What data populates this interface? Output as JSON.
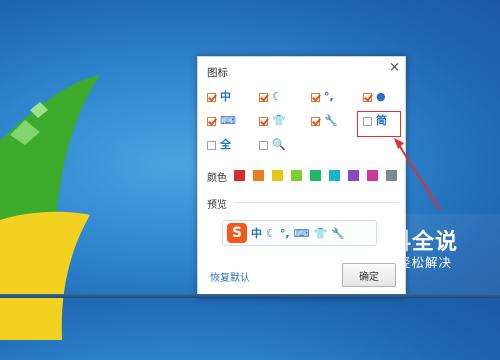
{
  "panel": {
    "title": "图标",
    "close_icon": "×",
    "icons": [
      {
        "name": "zhong-icon",
        "glyph": "中",
        "checked": true
      },
      {
        "name": "moon-icon",
        "glyph": "☾",
        "checked": true
      },
      {
        "name": "punctuation-icon",
        "glyph": "°,",
        "checked": true
      },
      {
        "name": "user-icon",
        "glyph": "●",
        "checked": true
      },
      {
        "name": "keyboard-icon",
        "glyph": "⌨",
        "checked": true
      },
      {
        "name": "shirt-icon",
        "glyph": "👕",
        "checked": true
      },
      {
        "name": "wrench-icon",
        "glyph": "🔧",
        "checked": true
      },
      {
        "name": "jian-icon",
        "glyph": "简",
        "checked": false
      },
      {
        "name": "quan-icon",
        "glyph": "全",
        "checked": false
      },
      {
        "name": "search-icon",
        "glyph": "🔍",
        "checked": false
      }
    ],
    "colors_label": "颜色",
    "colors": [
      "#d32f2f",
      "#e67e22",
      "#e6c619",
      "#7ccf2e",
      "#20b868",
      "#1cb4c8",
      "#8a46c9",
      "#d2369a",
      "#7b8794"
    ],
    "preview_label": "预览",
    "preview": {
      "logo": "S",
      "items": [
        "中",
        "☾",
        "°,",
        "⌨",
        "👕",
        "🔧"
      ]
    },
    "restore_label": "恢复默认",
    "confirm_label": "确定"
  },
  "watermark": {
    "title": "百科全说",
    "subtitle": "助你轻松解决"
  }
}
